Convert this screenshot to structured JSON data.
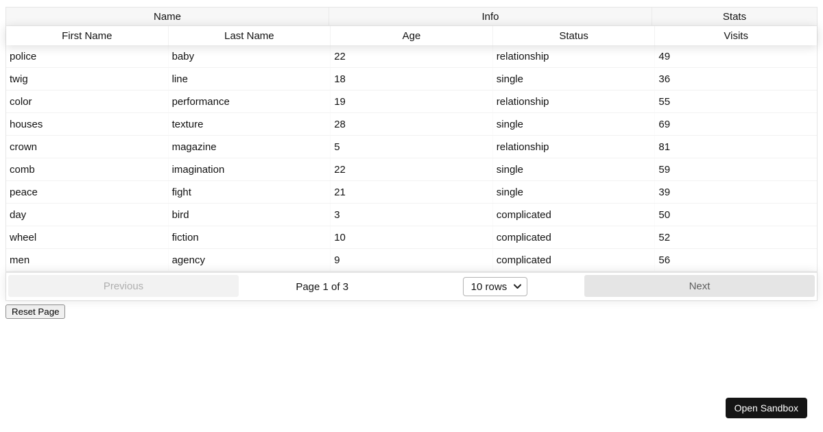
{
  "table": {
    "column_groups": [
      {
        "label": "Name",
        "span": 2
      },
      {
        "label": "Info",
        "span": 2
      },
      {
        "label": "Stats",
        "span": 1
      }
    ],
    "columns": [
      {
        "id": "first-name",
        "label": "First Name"
      },
      {
        "id": "last-name",
        "label": "Last Name"
      },
      {
        "id": "age",
        "label": "Age"
      },
      {
        "id": "status",
        "label": "Status"
      },
      {
        "id": "visits",
        "label": "Visits"
      }
    ],
    "rows": [
      [
        "police",
        "baby",
        22,
        "relationship",
        49
      ],
      [
        "twig",
        "line",
        18,
        "single",
        36
      ],
      [
        "color",
        "performance",
        19,
        "relationship",
        55
      ],
      [
        "houses",
        "texture",
        28,
        "single",
        69
      ],
      [
        "crown",
        "magazine",
        5,
        "relationship",
        81
      ],
      [
        "comb",
        "imagination",
        22,
        "single",
        59
      ],
      [
        "peace",
        "fight",
        21,
        "single",
        39
      ],
      [
        "day",
        "bird",
        3,
        "complicated",
        50
      ],
      [
        "wheel",
        "fiction",
        10,
        "complicated",
        52
      ],
      [
        "men",
        "agency",
        9,
        "complicated",
        56
      ]
    ]
  },
  "pagination": {
    "previous_label": "Previous",
    "previous_disabled": true,
    "page_info": "Page 1 of 3",
    "page_size_value": "10 rows",
    "next_label": "Next"
  },
  "reset_button_label": "Reset Page",
  "open_sandbox_label": "Open Sandbox",
  "colors": {
    "table_border": "#e6e6e6",
    "group_header_bg": "#f7f7f7",
    "row_divider": "#f2f2f2",
    "pagination_button_bg": "#e6e6e6",
    "pagination_button_text": "#666666",
    "sandbox_button_bg": "#151515",
    "sandbox_button_text": "#ffffff"
  }
}
